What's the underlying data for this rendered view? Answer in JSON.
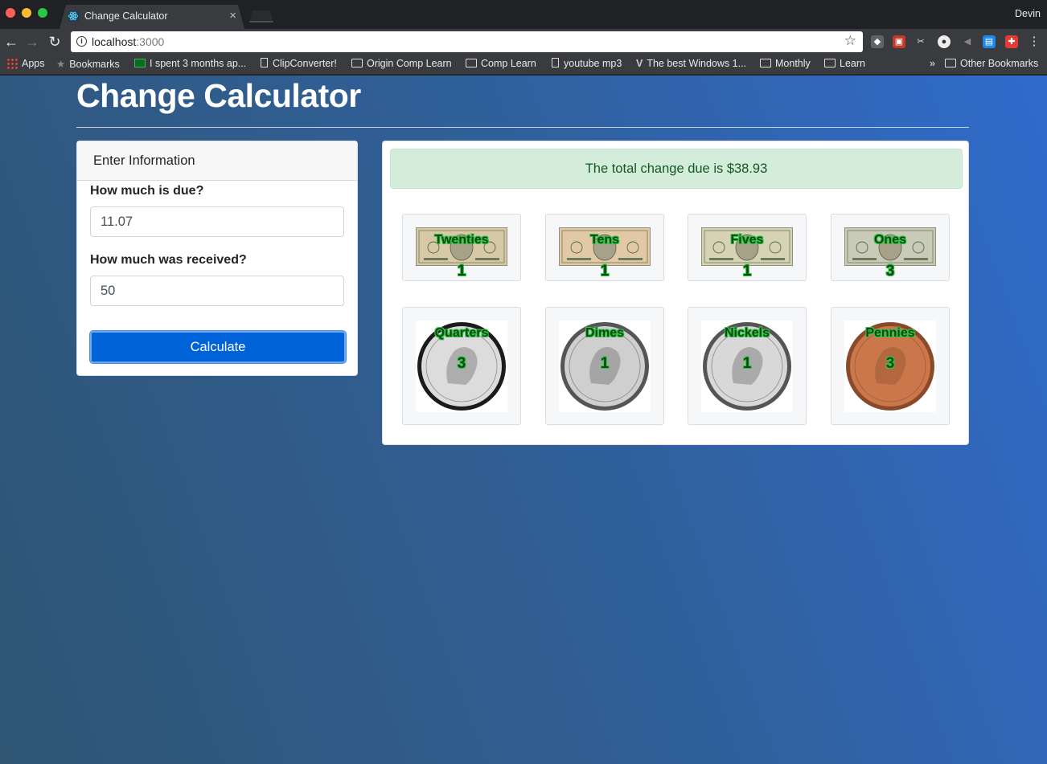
{
  "browser": {
    "tab_title": "Change Calculator",
    "profile_name": "Devin",
    "url_host": "localhost",
    "url_port": ":3000",
    "bookmarks": [
      {
        "label": "Apps",
        "icon": "apps-grid-icon"
      },
      {
        "label": "Bookmarks",
        "icon": "star-icon"
      },
      {
        "label": "I spent 3 months ap...",
        "icon": "site-icon"
      },
      {
        "label": "ClipConverter!",
        "icon": "page-icon"
      },
      {
        "label": "Origin Comp Learn",
        "icon": "folder-icon"
      },
      {
        "label": "Comp Learn",
        "icon": "folder-icon"
      },
      {
        "label": "youtube mp3",
        "icon": "page-icon"
      },
      {
        "label": "The best Windows 1...",
        "icon": "site-icon"
      },
      {
        "label": "Monthly",
        "icon": "folder-icon"
      },
      {
        "label": "Learn",
        "icon": "folder-icon"
      }
    ],
    "overflow_label": "»",
    "other_bookmarks": "Other Bookmarks"
  },
  "app": {
    "title": "Change Calculator",
    "form": {
      "header": "Enter Information",
      "due_label": "How much is due?",
      "due_value": "11.07",
      "received_label": "How much was received?",
      "received_value": "50",
      "button_label": "Calculate"
    },
    "result": {
      "message": "The total change due is $38.93"
    },
    "denominations": [
      {
        "name": "Twenties",
        "count": "1",
        "kind": "bill",
        "tint": "#d8c9a6"
      },
      {
        "name": "Tens",
        "count": "1",
        "kind": "bill",
        "tint": "#e2c8a4"
      },
      {
        "name": "Fives",
        "count": "1",
        "kind": "bill",
        "tint": "#d6d3b4"
      },
      {
        "name": "Ones",
        "count": "3",
        "kind": "bill",
        "tint": "#c9cbb8"
      },
      {
        "name": "Quarters",
        "count": "3",
        "kind": "coin",
        "tint": "#dcdcdc"
      },
      {
        "name": "Dimes",
        "count": "1",
        "kind": "coin",
        "tint": "#cfcfcf"
      },
      {
        "name": "Nickels",
        "count": "1",
        "kind": "coin",
        "tint": "#d8d8d8"
      },
      {
        "name": "Pennies",
        "count": "3",
        "kind": "coin",
        "tint": "#c9774b"
      }
    ]
  },
  "colors": {
    "primary_button": "#0062d8",
    "alert_bg": "#d4edda",
    "alert_text": "#155724",
    "label_outline": "#37c24a"
  }
}
